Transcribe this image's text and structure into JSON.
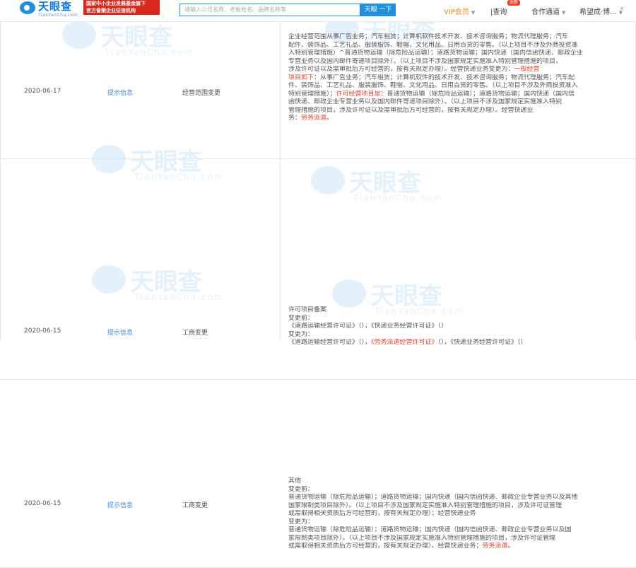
{
  "header": {
    "logo_text": "天眼查",
    "logo_sub": "TianYanCha.com",
    "promo_line1": "国家中小企业发展基金旗下",
    "promo_line2": "官方备案企业征信机构",
    "search_placeholder": "请输入公司名称、老板姓名、品牌名称等",
    "search_button": "天眼 一下",
    "vip_label": "VIP会员",
    "nav_items": [
      "|查询",
      "合作通道"
    ],
    "nav_badge": "出新",
    "user_label": "希望成·博...",
    "close_glyph": "×"
  },
  "watermark": {
    "text": "天眼查",
    "sub": "TianYanCha.com"
  },
  "rows": [
    {
      "date": "2020-06-17",
      "link": "提示信息",
      "type": "经营范围变更",
      "lines": [
        [
          {
            "t": "企业经营范围从事广告业务；汽车租赁；计算机软件技术开发、技术咨询服务；物流代理服务；汽车"
          }
        ],
        [
          {
            "t": "配件、装饰品、工艺礼品、服装服饰、鞋帽、文化用品、日用百货的零售。（以上项目不涉及外商投资准"
          }
        ],
        [
          {
            "t": "入特别管理措施）^普通货物运输（除危险品运输）；道路货物运输；国内快递（国内信函快递、邮政企业"
          }
        ],
        [
          {
            "t": "专营业务以及国内邮件寄递项目除外）。（以上项目不涉及国家规定实施准入特别管理措施的项目，"
          }
        ],
        [
          {
            "t": "涉及许可证以及需审批后方可经营的，按有关规定办理）。经营快递业务变更为："
          },
          {
            "t": "一般经营",
            "h": true
          }
        ],
        [
          {
            "t": "项目如下",
            "h": true
          },
          {
            "t": "：从事广告业务；汽车租赁；计算机软件的技术开发、技术咨询服务；物流代理服务；汽车配"
          }
        ],
        [
          {
            "t": "件、装饰品、工艺礼品、服装服饰、鞋帽、文化用品、日用百货的零售。（以上项目不涉及外商投资准入"
          }
        ],
        [
          {
            "t": "特别管理措施）；"
          },
          {
            "t": "许可经营项目是",
            "h": true
          },
          {
            "t": "：普通货物运输（除危险品运输）；道路货物运输；国内快递（国内信"
          }
        ],
        [
          {
            "t": "函快递、邮政企业专营业务以及国内邮件寄递项目除外）。（以上项目不涉及国家规定实施准入特别"
          }
        ],
        [
          {
            "t": "管理措施的项目，涉及许可证以及需审批后方可经营的，按有关规定办理）。经营快递业"
          }
        ],
        [
          {
            "t": "务："
          },
          {
            "t": "劳务派遣",
            "h": true
          },
          {
            "t": "。"
          }
        ]
      ]
    },
    {
      "date": "2020-06-15",
      "link": "提示信息",
      "type": "工商变更",
      "lines": [
        [
          {
            "t": "许可项目备案"
          }
        ],
        [
          {
            "t": "变更前："
          }
        ],
        [
          {
            "t": "《道路运输经营许可证》（），《快递业务经营许可证》（）"
          }
        ],
        [
          {
            "t": "变更为："
          }
        ],
        [
          {
            "t": "《道路运输经营许可证》（），"
          },
          {
            "t": "《劳务派遣经营许可证》",
            "h": true
          },
          {
            "t": "（），《快递业务经营许可证》（）"
          }
        ]
      ]
    },
    {
      "date": "2020-06-15",
      "link": "提示信息",
      "type": "工商变更",
      "lines": [
        [
          {
            "t": "其他"
          }
        ],
        [
          {
            "t": "变更前："
          }
        ],
        [
          {
            "t": "普通货物运输（除危险品运输）；道路货物运输；国内快递（国内信函快递、邮政企业专营业务以及其他"
          }
        ],
        [
          {
            "t": "国家限制类项目除外）。（以上项目不涉及国家规定实施准入特别管理措施的项目，涉及许可证管理"
          }
        ],
        [
          {
            "t": "或需取得相关资质后方可经营的，按有关规定办理）；经营快递业务"
          }
        ],
        [
          {
            "t": "变更为："
          }
        ],
        [
          {
            "t": "普通货物运输（除危险品运输）；道路货物运输；国内快递（国内信函快递、邮政企业专营业务以及国"
          }
        ],
        [
          {
            "t": "家限制类项目除外）。（以上项目不涉及国家规定实施准入特别管理措施的项目，涉及许可证管理"
          }
        ],
        [
          {
            "t": "或需取得相关资质后方可经营的，按有关规定办理）。经营快递业务；"
          },
          {
            "t": "劳务派遣",
            "h": true
          },
          {
            "t": "。"
          }
        ]
      ]
    }
  ]
}
